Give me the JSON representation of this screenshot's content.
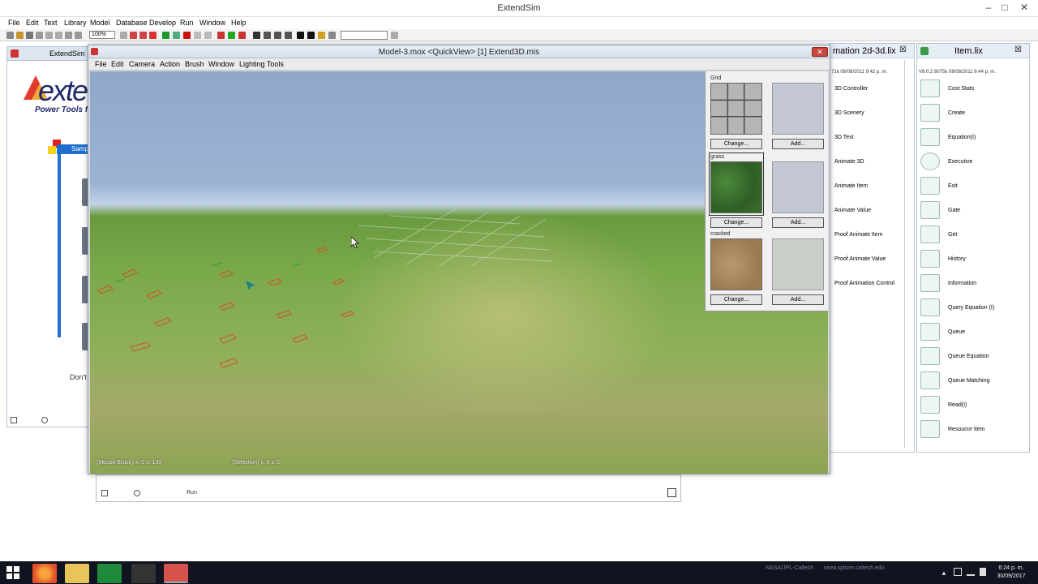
{
  "app": {
    "title": "ExtendSim",
    "window_controls": [
      "–",
      "□",
      "✕"
    ]
  },
  "menubar": [
    "File",
    "Edit",
    "Text",
    "Library",
    "Model",
    "Database",
    "Develop",
    "Run",
    "Window",
    "Help"
  ],
  "toolbar": {
    "zoom": "100%"
  },
  "bg_left_window": {
    "title": "ExtendSim",
    "logo_text": "exte",
    "tagline": "Power Tools fo",
    "sample_button": "Samp",
    "dont_label": "Don't s"
  },
  "bg_bottom_window": {
    "run_label": "Run"
  },
  "quickview": {
    "title": "Model-3.mox  <QuickView>  [1]  Extend3D.mis",
    "close_glyph": "✕",
    "menu": [
      "File",
      "Edit",
      "Camera",
      "Action",
      "Brush",
      "Window",
      "Lighting Tools"
    ],
    "status_left": "(Mouse Brush) x: 0  z: 100",
    "status_right": "(Selection) x: 0  z: 0",
    "palette": {
      "sections": [
        {
          "label": "Grid",
          "change": "Change...",
          "add": "Add..."
        },
        {
          "label": "grass",
          "change": "Change...",
          "add": "Add..."
        },
        {
          "label": "cracked",
          "change": "Change...",
          "add": "Add..."
        }
      ]
    }
  },
  "lib_animation": {
    "title": "mation 2d-3d.lix",
    "close": "☒",
    "sub": "71k  08/08/2011 9:42 p. m.",
    "items": [
      "3D Controller",
      "3D Scenery",
      "3D Text",
      "Animate 3D",
      "Animate Item",
      "Animate Value",
      "Proof Animate Item",
      "Proof Animate Value",
      "Proof Animation Control"
    ]
  },
  "lib_item": {
    "title": "Item.lix",
    "close": "☒",
    "sub": "V8.0.2   8075k   08/08/2011 9:44 p. m.",
    "items": [
      "Cost Stats",
      "Create",
      "Equation(I)",
      "Executive",
      "Exit",
      "Gate",
      "Get",
      "History",
      "Information",
      "Query Equation (I)",
      "Queue",
      "Queue Equation",
      "Queue Matching",
      "Read(I)",
      "Resource Item"
    ]
  },
  "taskbar": {
    "watermark": "NASA/JPL-Caltech",
    "watermark2": "www.spitzer.caltech.edu",
    "time": "6:24 p. m.",
    "date": "30/09/2017"
  },
  "colors": {
    "accent": "#1e6fd0",
    "sky": "#8fa7cb",
    "grass": "#6a9a3e",
    "taskbar": "#0f1420"
  }
}
